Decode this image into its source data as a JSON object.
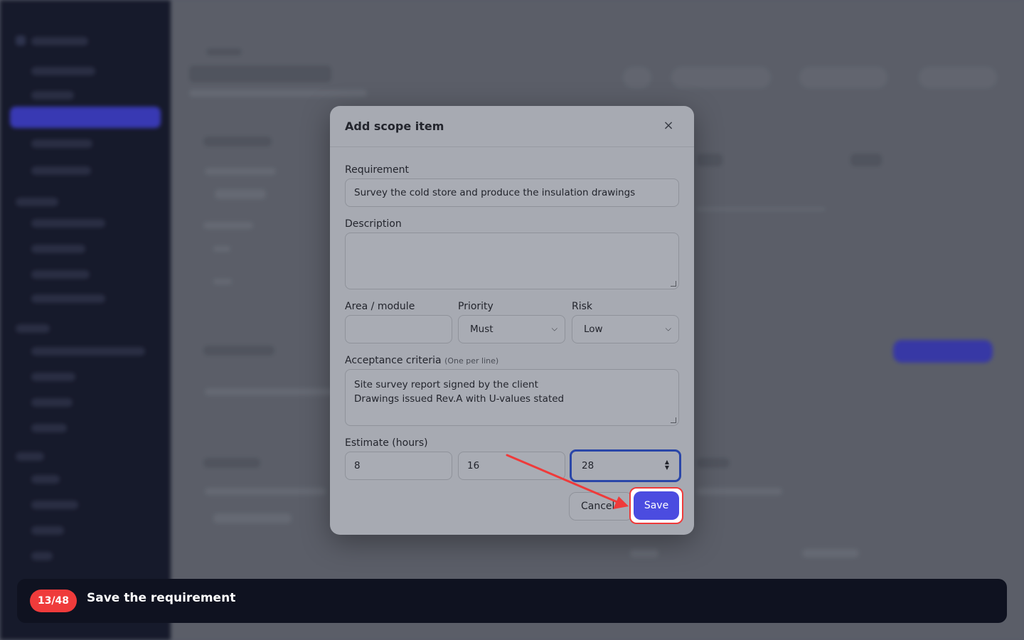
{
  "modal": {
    "title": "Add scope item",
    "close_icon": "×",
    "requirement": {
      "label": "Requirement",
      "value": "Survey the cold store and produce the insulation drawings"
    },
    "description": {
      "label": "Description",
      "value": ""
    },
    "area": {
      "label": "Area / module",
      "value": ""
    },
    "priority": {
      "label": "Priority",
      "value": "Must"
    },
    "risk": {
      "label": "Risk",
      "value": "Low"
    },
    "acceptance": {
      "label": "Acceptance criteria",
      "hint": "(One per line)",
      "value": "Site survey report signed by the client\nDrawings issued Rev.A with U-values stated"
    },
    "estimate": {
      "label": "Estimate (hours)",
      "values": [
        "8",
        "16",
        "28"
      ]
    },
    "cancel_label": "Cancel",
    "save_label": "Save"
  },
  "tutorial": {
    "step": "13/48",
    "instruction": "Save the requirement"
  },
  "colors": {
    "primary": "#4b4ce0",
    "highlight": "#ef3a3a",
    "focus": "#2a46a8"
  }
}
